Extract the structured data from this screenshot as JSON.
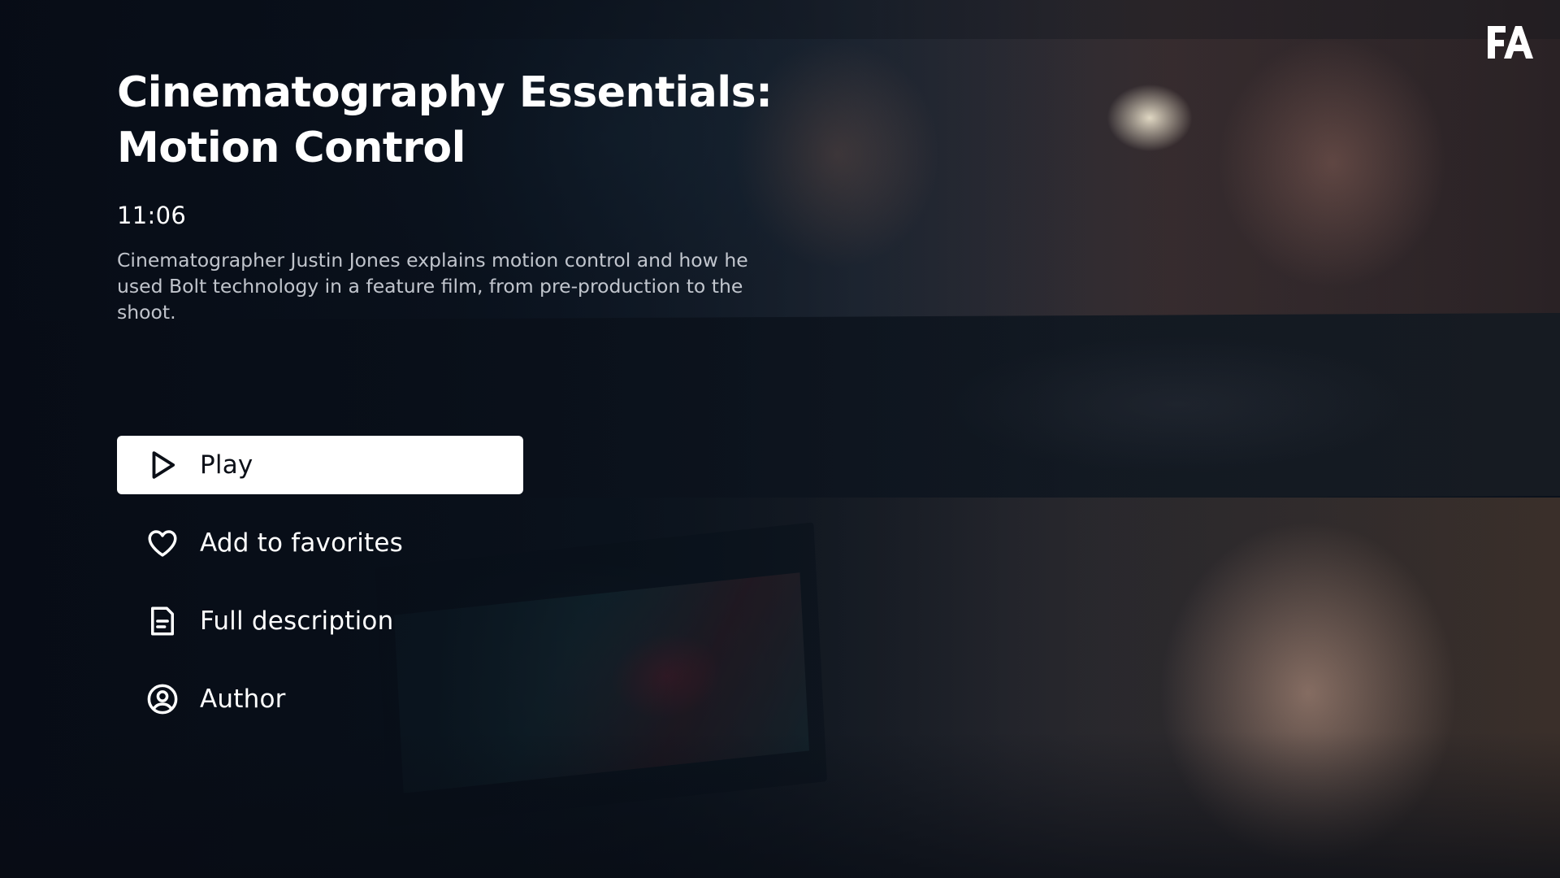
{
  "brand": {
    "logo_text": "FA"
  },
  "video": {
    "title": "Cinematography Essentials: Motion Control",
    "duration": "11:06",
    "description": "Cinematographer Justin Jones explains motion control and how he used  Bolt technology in a feature film, from pre-production to the shoot."
  },
  "actions": {
    "play": {
      "label": "Play",
      "icon": "play-icon"
    },
    "favorites": {
      "label": "Add to favorites",
      "icon": "heart-icon"
    },
    "full_description": {
      "label": "Full description",
      "icon": "document-icon"
    },
    "author": {
      "label": "Author",
      "icon": "user-circle-icon"
    }
  },
  "colors": {
    "primary_button_bg": "#ffffff",
    "primary_button_text": "#0b0f17",
    "text": "#ffffff",
    "background": "#0a111c"
  }
}
